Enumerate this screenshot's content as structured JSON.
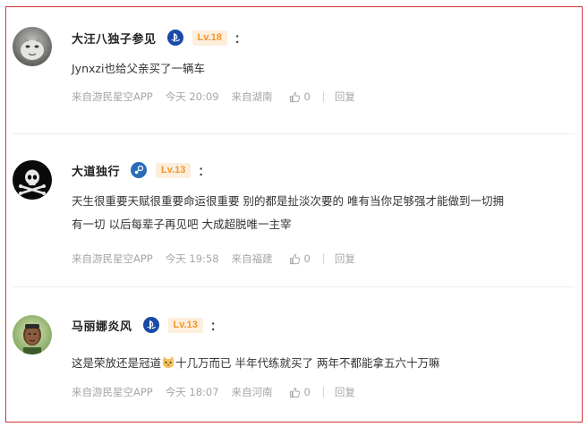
{
  "comments": [
    {
      "name": "大汪八独子参见",
      "platform_icon": "playstation-icon",
      "level": "Lv.18",
      "colon": "：",
      "text": "Jynxzi也给父亲买了一辆车",
      "source": "来自游民星空APP",
      "time": "今天 20:09",
      "location": "来自湖南",
      "likes": "0",
      "reply": "回复"
    },
    {
      "name": "大道独行",
      "platform_icon": "steam-icon",
      "level": "Lv.13",
      "colon": "：",
      "text_line1": "天生很重要天赋很重要命运很重要 别的都是扯淡次要的 唯有当你足够强才能做到一切拥",
      "text_line2": "有一切 以后每辈子再见吧 大成超脱唯一主宰",
      "source": "来自游民星空APP",
      "time": "今天 19:58",
      "location": "来自福建",
      "likes": "0",
      "reply": "回复"
    },
    {
      "name": "马丽娜炎风",
      "platform_icon": "playstation-icon",
      "level": "Lv.13",
      "colon": "：",
      "text_before_emoji": "这是荣放还是冠道",
      "emoji": "cat-emoji-icon",
      "text_after_emoji": "十几万而已  半年代练就买了 两年不都能拿五六十万嘛",
      "source": "来自游民星空APP",
      "time": "今天 18:07",
      "location": "来自河南",
      "likes": "0",
      "reply": "回复"
    }
  ],
  "colors": {
    "border": "#d9313a",
    "level_bg": "#fdeedd",
    "level_text": "#f0962c",
    "meta_text": "#a6a6a6",
    "platform_blue": "#1a4aa8"
  }
}
